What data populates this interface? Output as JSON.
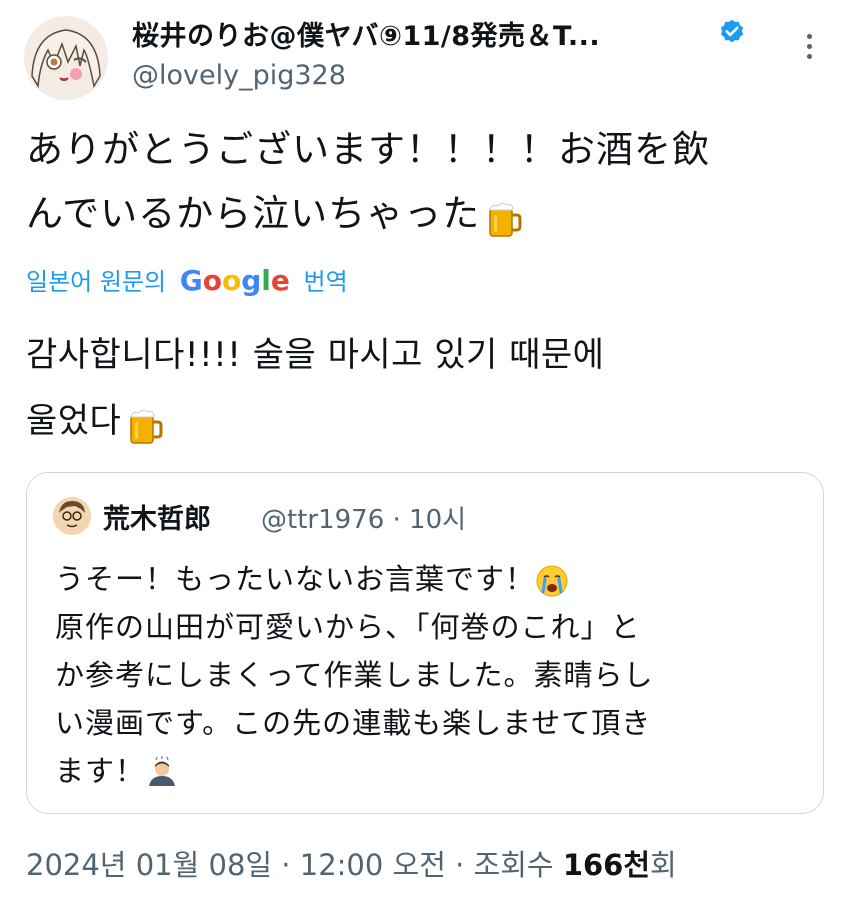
{
  "author": {
    "display_name": "桜井のりお@僕ヤバ⑨11/8発売＆T...",
    "handle": "@lovely_pig328",
    "verified": true,
    "verified_color": "#1d9bf0"
  },
  "tweet": {
    "text_line1": "ありがとうございます！！！！お酒を飲",
    "text_line2": "んでいるから泣いちゃった",
    "emoji_end": "beer-mug",
    "translate_prefix": "일본어 원문의",
    "translate_brand": "Google",
    "translate_suffix": "번역",
    "translation_line1": "감사합니다!!!! 술을 마시고 있기 때문에",
    "translation_line2": "울었다"
  },
  "quote": {
    "display_name": "荒木哲郎",
    "handle_time": "@ttr1976 · 10시",
    "line1": "うそー！もったいないお言葉です！",
    "line2": "原作の山田が可愛いから、「何巻のこれ」と",
    "line3": "か参考にしまくって作業しました。素晴らし",
    "line4": "い漫画です。この先の連載も楽しませて頂き",
    "line5": "ます！"
  },
  "meta": {
    "datetime": "2024년 01월 08일 · 12:00 오전 · 조회수",
    "views": "166천",
    "views_suffix": "회"
  },
  "colors": {
    "text": "#0f1419",
    "secondary": "#536471",
    "link": "#1d9bf0",
    "border": "#cfd9de"
  }
}
